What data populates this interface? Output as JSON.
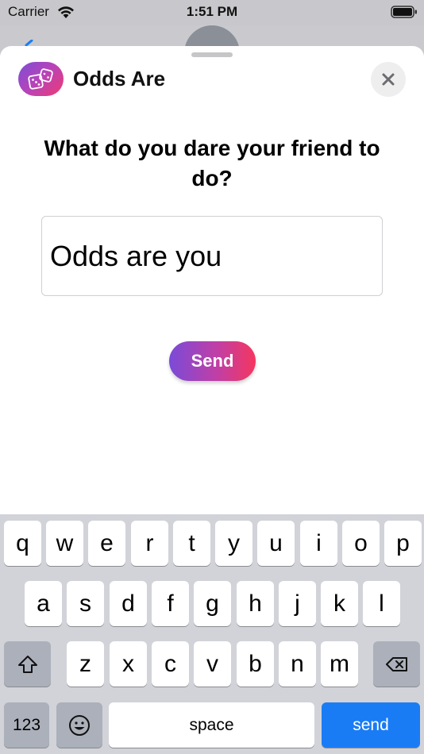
{
  "status_bar": {
    "carrier": "Carrier",
    "time": "1:51 PM"
  },
  "sheet": {
    "app_title": "Odds Are",
    "question": "What do you dare your friend to do?",
    "input_value": "Odds are you",
    "send_label": "Send"
  },
  "keyboard": {
    "row1": [
      "q",
      "w",
      "e",
      "r",
      "t",
      "y",
      "u",
      "i",
      "o",
      "p"
    ],
    "row2": [
      "a",
      "s",
      "d",
      "f",
      "g",
      "h",
      "j",
      "k",
      "l"
    ],
    "row3": [
      "z",
      "x",
      "c",
      "v",
      "b",
      "n",
      "m"
    ],
    "numbers_label": "123",
    "space_label": "space",
    "send_label": "send"
  },
  "colors": {
    "accent_gradient_start": "#7a4bd8",
    "accent_gradient_end": "#f5365f",
    "keyboard_send": "#1a7cf5"
  },
  "icons": {
    "app": "dice-icon",
    "close": "close-icon",
    "shift": "shift-icon",
    "backspace": "backspace-icon",
    "emoji": "emoji-icon",
    "wifi": "wifi-icon",
    "battery": "battery-icon"
  }
}
